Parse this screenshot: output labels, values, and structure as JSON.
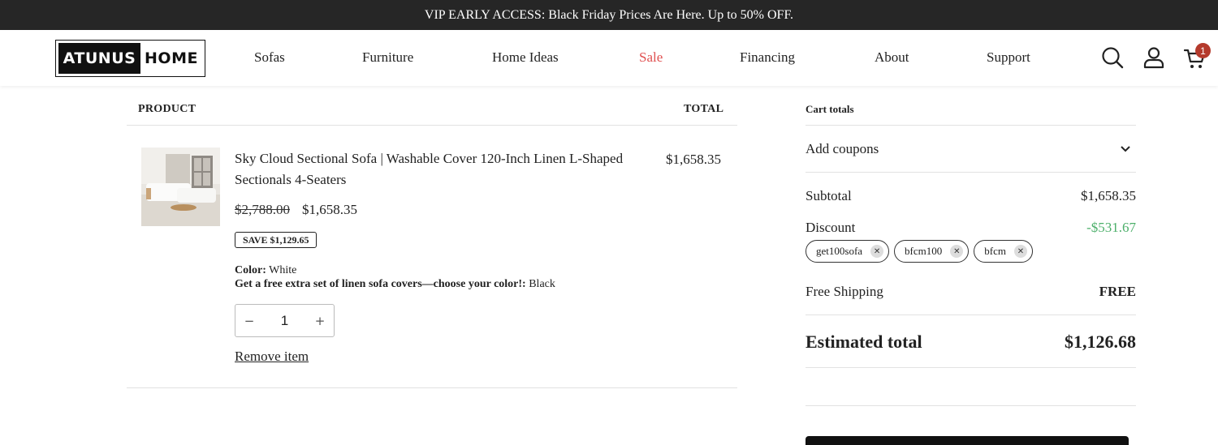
{
  "announcement": "VIP EARLY ACCESS: Black Friday Prices Are Here. Up to 50% OFF.",
  "logo": {
    "part1": "ATUNUS",
    "part2": "HOME"
  },
  "nav": {
    "sofas": "Sofas",
    "furniture": "Furniture",
    "home_ideas": "Home Ideas",
    "sale": "Sale",
    "financing": "Financing",
    "about": "About",
    "support": "Support"
  },
  "header_icons": {
    "search": "search-icon",
    "account": "user-icon",
    "cart": "cart-icon",
    "cart_count": "1"
  },
  "cart_table": {
    "col_product": "PRODUCT",
    "col_total": "TOTAL",
    "item": {
      "name": "Sky Cloud Sectional Sofa | Washable Cover 120-Inch Linen L-Shaped Sectionals 4-Seaters",
      "line_total": "$1,658.35",
      "original_price": "$2,788.00",
      "price": "$1,658.35",
      "save_badge": "SAVE $1,129.65",
      "option1_label": "Color:",
      "option1_value": "White",
      "option2_label": "Get a free extra set of linen sofa covers—choose your color!:",
      "option2_value": "Black",
      "quantity": "1",
      "minus": "−",
      "plus": "+",
      "remove": "Remove item"
    }
  },
  "cart_totals": {
    "heading": "Cart totals",
    "add_coupons": "Add coupons",
    "subtotal_label": "Subtotal",
    "subtotal_value": "$1,658.35",
    "discount_label": "Discount",
    "discount_value": "-$531.67",
    "coupons": [
      "get100sofa",
      "bfcm100",
      "bfcm"
    ],
    "shipping_label": "Free Shipping",
    "shipping_value": "FREE",
    "estimated_label": "Estimated total",
    "estimated_value": "$1,126.68"
  },
  "colors": {
    "sale": "#e05050",
    "discount": "#4caf6a",
    "announcement_bg": "#262626",
    "cart_badge": "#b43a2c"
  }
}
